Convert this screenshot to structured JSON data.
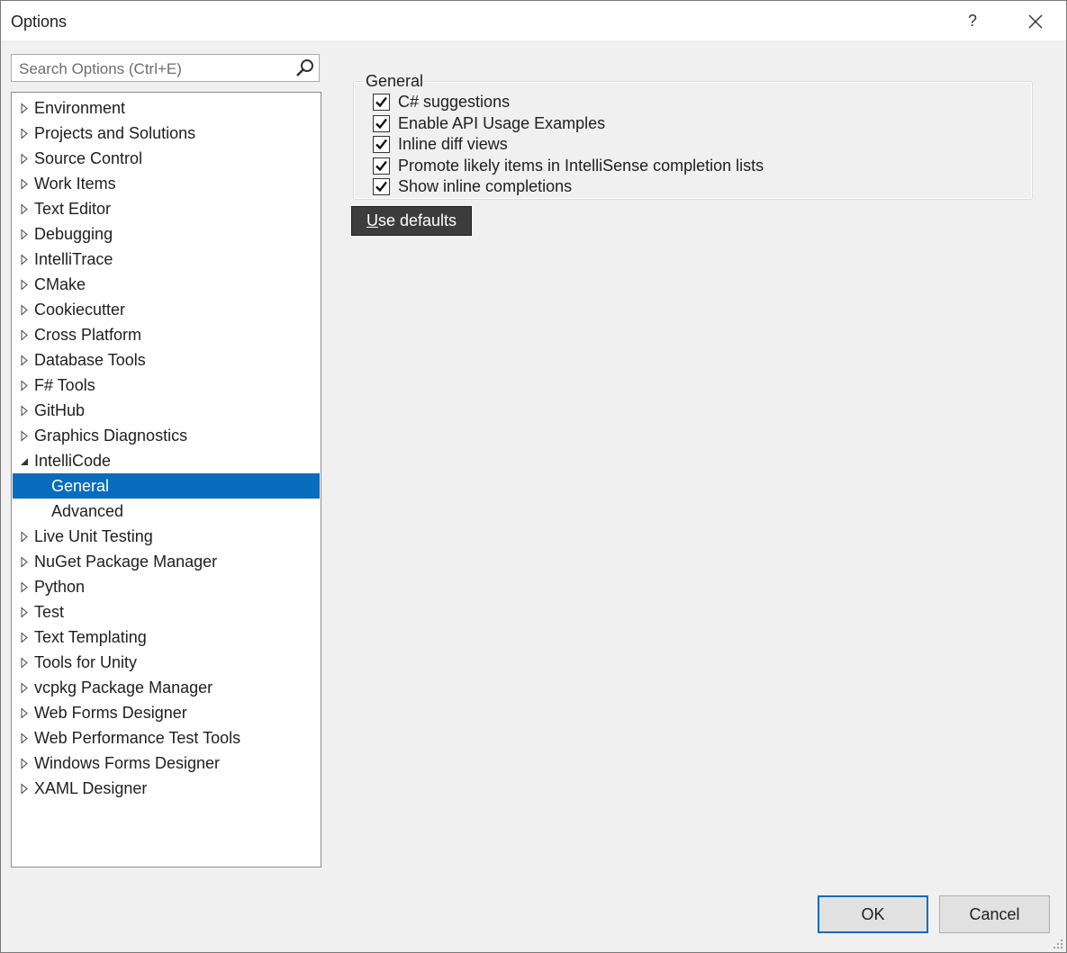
{
  "window": {
    "title": "Options",
    "help_label": "?"
  },
  "search": {
    "placeholder": "Search Options (Ctrl+E)",
    "value": ""
  },
  "tree": {
    "items": [
      {
        "label": "Environment",
        "state": "collapsed"
      },
      {
        "label": "Projects and Solutions",
        "state": "collapsed"
      },
      {
        "label": "Source Control",
        "state": "collapsed"
      },
      {
        "label": "Work Items",
        "state": "collapsed"
      },
      {
        "label": "Text Editor",
        "state": "collapsed"
      },
      {
        "label": "Debugging",
        "state": "collapsed"
      },
      {
        "label": "IntelliTrace",
        "state": "collapsed"
      },
      {
        "label": "CMake",
        "state": "collapsed"
      },
      {
        "label": "Cookiecutter",
        "state": "collapsed"
      },
      {
        "label": "Cross Platform",
        "state": "collapsed"
      },
      {
        "label": "Database Tools",
        "state": "collapsed"
      },
      {
        "label": "F# Tools",
        "state": "collapsed"
      },
      {
        "label": "GitHub",
        "state": "collapsed"
      },
      {
        "label": "Graphics Diagnostics",
        "state": "collapsed"
      },
      {
        "label": "IntelliCode",
        "state": "expanded"
      },
      {
        "label": "General",
        "state": "child",
        "selected": true
      },
      {
        "label": "Advanced",
        "state": "child"
      },
      {
        "label": "Live Unit Testing",
        "state": "collapsed"
      },
      {
        "label": "NuGet Package Manager",
        "state": "collapsed"
      },
      {
        "label": "Python",
        "state": "collapsed"
      },
      {
        "label": "Test",
        "state": "collapsed"
      },
      {
        "label": "Text Templating",
        "state": "collapsed"
      },
      {
        "label": "Tools for Unity",
        "state": "collapsed"
      },
      {
        "label": "vcpkg Package Manager",
        "state": "collapsed"
      },
      {
        "label": "Web Forms Designer",
        "state": "collapsed"
      },
      {
        "label": "Web Performance Test Tools",
        "state": "collapsed"
      },
      {
        "label": "Windows Forms Designer",
        "state": "collapsed"
      },
      {
        "label": "XAML Designer",
        "state": "collapsed"
      }
    ]
  },
  "general_group": {
    "title": "General",
    "checkboxes": [
      {
        "label": "C# suggestions",
        "checked": true
      },
      {
        "label": "Enable API Usage Examples",
        "checked": true
      },
      {
        "label": "Inline diff views",
        "checked": true
      },
      {
        "label": "Promote likely items in IntelliSense completion lists",
        "checked": true
      },
      {
        "label": "Show inline completions",
        "checked": true
      }
    ]
  },
  "use_defaults": {
    "mnemonic": "U",
    "rest": "se defaults"
  },
  "footer": {
    "ok_label": "OK",
    "cancel_label": "Cancel"
  },
  "colors": {
    "selection": "#0a6cbc",
    "dialog_bg": "#f0f0f0",
    "button_dark": "#3c3c3c"
  }
}
